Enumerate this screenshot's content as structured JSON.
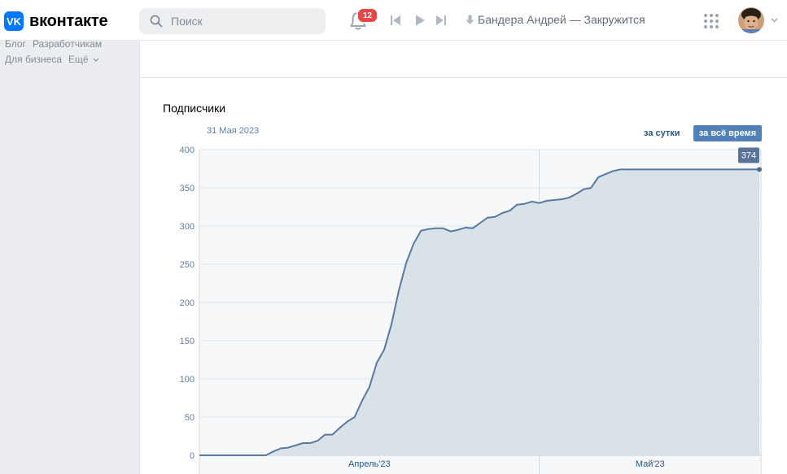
{
  "header": {
    "logo_text": "вконтакте",
    "logo_badge": "VK",
    "search_placeholder": "Поиск",
    "notifications_count": "12",
    "now_playing": "Бандера Андрей — Закружится",
    "icons": [
      "search-icon",
      "bell-icon",
      "prev-track-icon",
      "play-icon",
      "next-track-icon",
      "download-icon",
      "apps-grid-icon",
      "chevron-down-icon"
    ]
  },
  "left_menu": {
    "links_row1": [
      "Блог",
      "Разработчикам"
    ],
    "links_row2": [
      "Для бизнеса",
      "Ещё"
    ]
  },
  "stats": {
    "title": "Подписчики",
    "date": "31 Мая 2023",
    "period_day": "за сутки",
    "period_all": "за всё время",
    "tooltip_value": "374"
  },
  "colors": {
    "accent": "#5181b8",
    "line": "#587aa0",
    "fill": "#d9e1e9",
    "badge": "#e64646",
    "vk_blue": "#0077ff"
  },
  "chart_data": {
    "type": "area",
    "title": "Подписчики",
    "xlabel": "",
    "ylabel": "",
    "ylim": [
      0,
      400
    ],
    "yticks": [
      0,
      50,
      100,
      150,
      200,
      250,
      300,
      350,
      400
    ],
    "x_labels": [
      "Апрель'23",
      "Май'23"
    ],
    "x_start": "2023-03-16",
    "x_end": "2023-05-31",
    "series": [
      {
        "name": "",
        "x": [
          "2023-03-16",
          "2023-03-17",
          "2023-03-18",
          "2023-03-19",
          "2023-03-20",
          "2023-03-21",
          "2023-03-22",
          "2023-03-23",
          "2023-03-24",
          "2023-03-25",
          "2023-03-26",
          "2023-03-27",
          "2023-03-28",
          "2023-03-29",
          "2023-03-30",
          "2023-03-31",
          "2023-04-01",
          "2023-04-02",
          "2023-04-03",
          "2023-04-04",
          "2023-04-05",
          "2023-04-06",
          "2023-04-07",
          "2023-04-08",
          "2023-04-09",
          "2023-04-10",
          "2023-04-11",
          "2023-04-12",
          "2023-04-13",
          "2023-04-14",
          "2023-04-15",
          "2023-04-16",
          "2023-04-17",
          "2023-04-18",
          "2023-04-19",
          "2023-04-20",
          "2023-04-21",
          "2023-04-22",
          "2023-04-23",
          "2023-04-24",
          "2023-04-25",
          "2023-04-26",
          "2023-04-27",
          "2023-04-28",
          "2023-04-29",
          "2023-04-30",
          "2023-05-01",
          "2023-05-02",
          "2023-05-03",
          "2023-05-04",
          "2023-05-05",
          "2023-05-06",
          "2023-05-07",
          "2023-05-08",
          "2023-05-09",
          "2023-05-10",
          "2023-05-11",
          "2023-05-12",
          "2023-05-13",
          "2023-05-14",
          "2023-05-15",
          "2023-05-16",
          "2023-05-17",
          "2023-05-18",
          "2023-05-19",
          "2023-05-20",
          "2023-05-21",
          "2023-05-22",
          "2023-05-23",
          "2023-05-24",
          "2023-05-25",
          "2023-05-26",
          "2023-05-27",
          "2023-05-28",
          "2023-05-29",
          "2023-05-30",
          "2023-05-31"
        ],
        "values": [
          0,
          0,
          0,
          0,
          0,
          0,
          0,
          0,
          0,
          0,
          5,
          9,
          10,
          13,
          16,
          16,
          19,
          27,
          27,
          36,
          44,
          50,
          71,
          89,
          121,
          138,
          172,
          216,
          252,
          277,
          294,
          296,
          297,
          297,
          293,
          295,
          298,
          297,
          304,
          311,
          312,
          317,
          320,
          328,
          329,
          332,
          330,
          333,
          334,
          335,
          337,
          342,
          348,
          350,
          364,
          368,
          372,
          374,
          374,
          374,
          374,
          374,
          374,
          374,
          374,
          374,
          374,
          374,
          374,
          374,
          374,
          374,
          374,
          374,
          374,
          374,
          374
        ]
      }
    ]
  }
}
